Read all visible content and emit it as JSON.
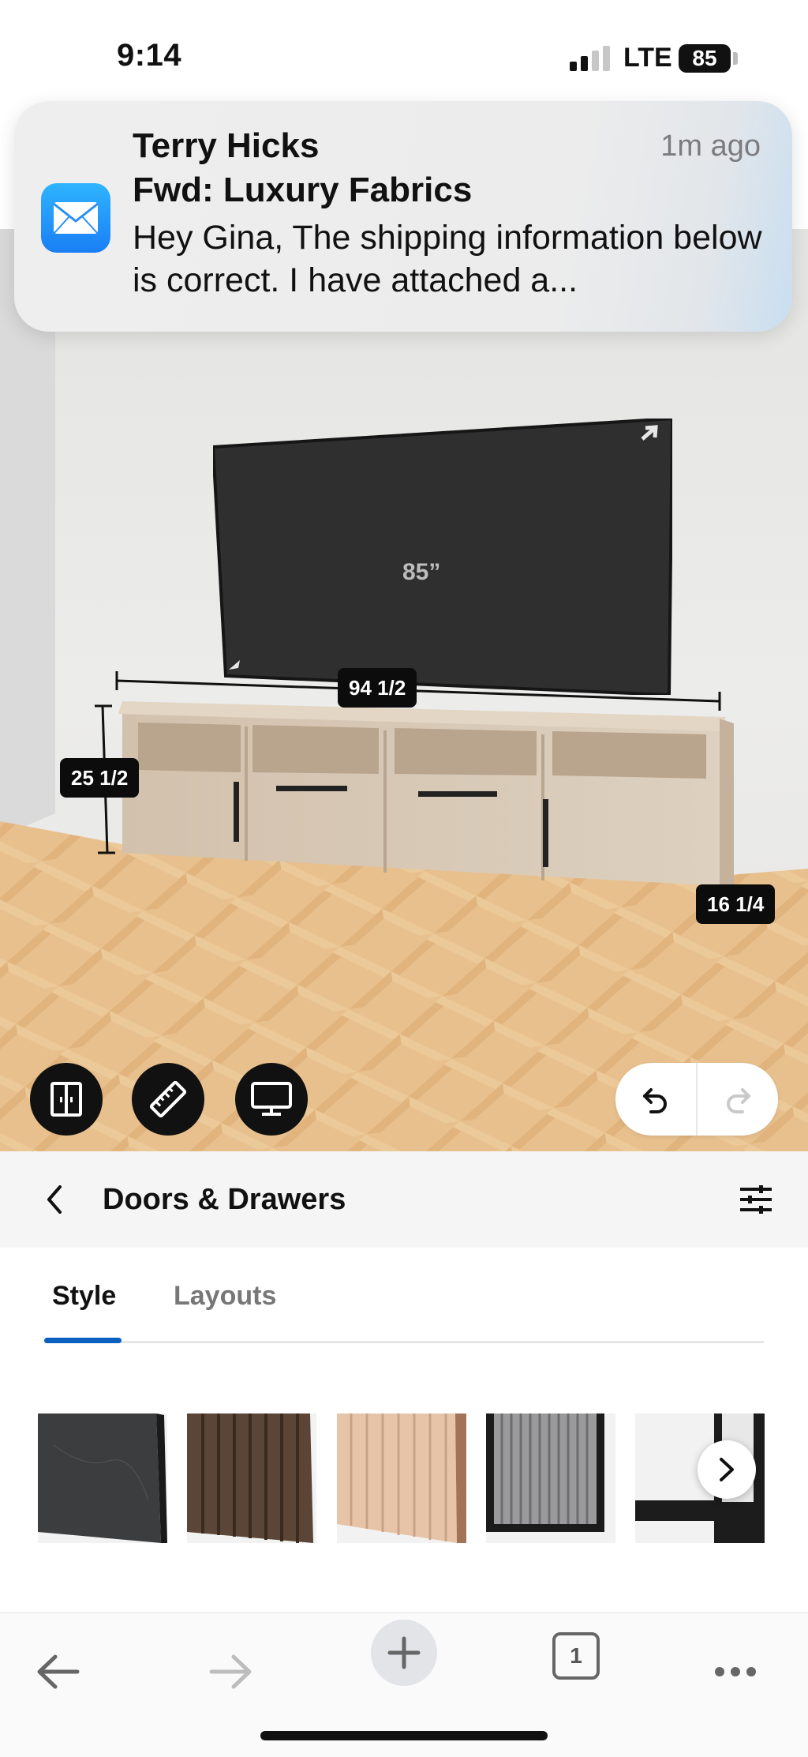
{
  "status_bar": {
    "time": "9:14",
    "network": "LTE",
    "battery": "85"
  },
  "notification": {
    "app_icon": "mail-icon",
    "sender": "Terry Hicks",
    "time": "1m ago",
    "subject": "Fwd: Luxury Fabrics",
    "body": "Hey Gina, The shipping information below is correct. I have attached a..."
  },
  "scene": {
    "tv_size": "85”",
    "width_label": "94 1/2",
    "height_label": "25 1/2",
    "depth_label": "16 1/4",
    "tools": [
      {
        "icon": "door-panel-icon"
      },
      {
        "icon": "ruler-icon"
      },
      {
        "icon": "monitor-icon"
      }
    ],
    "undo_icon": "undo-icon",
    "redo_icon": "redo-icon"
  },
  "panel": {
    "title": "Doors & Drawers",
    "back_icon": "chevron-left-icon",
    "filter_icon": "sliders-icon",
    "tabs": [
      {
        "label": "Style",
        "active": true
      },
      {
        "label": "Layouts",
        "active": false
      }
    ],
    "swatches": [
      {
        "name": "dark-marble",
        "color": "#3c3d3f"
      },
      {
        "name": "walnut-slat",
        "color": "#5a4536"
      },
      {
        "name": "light-oak-slat",
        "color": "#e7c4a8"
      },
      {
        "name": "grey-reeded-glass",
        "color": "#9a9a9c"
      },
      {
        "name": "black-frame-glass",
        "color": "#1c1c1c"
      }
    ],
    "next_icon": "chevron-right-icon"
  },
  "browser_bar": {
    "back_icon": "arrow-left-icon",
    "forward_icon": "arrow-right-icon",
    "add_icon": "plus-icon",
    "tab_count": "1",
    "more_icon": "more-horizontal-icon"
  },
  "colors": {
    "accent": "#0b5fbf",
    "tool_button": "#111111",
    "badge": "#0c0c0c"
  }
}
